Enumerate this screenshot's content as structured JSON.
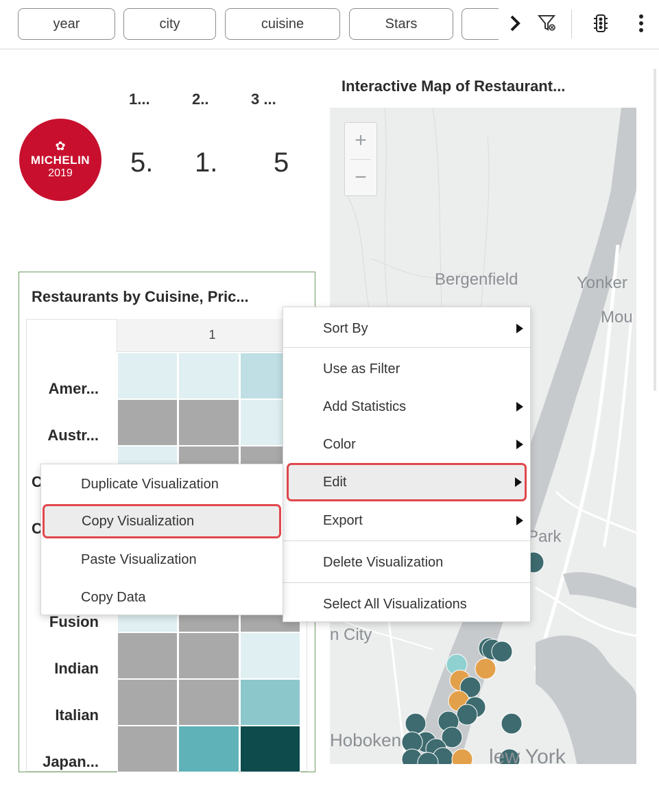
{
  "filterbar": {
    "pills": [
      "year",
      "city",
      "cuisine",
      "Stars",
      ""
    ],
    "icons": [
      "chevron-right-icon",
      "filter-icon",
      "traffic-light-icon",
      "kebab-menu-icon"
    ]
  },
  "kpi": {
    "headers": [
      "1...",
      "2..",
      "3 ..."
    ],
    "values": [
      "5.",
      "1.",
      "5"
    ],
    "badge": {
      "icon": "michelin-star-icon",
      "brand": "MICHELIN",
      "year": "2019"
    }
  },
  "heatmap": {
    "title": "Restaurants by Cuisine, Pric...",
    "column_header": "1",
    "rows": [
      "Amer...",
      "Austr...",
      "C",
      "C",
      "",
      "Fusion",
      "Indian",
      "Italian",
      "Japan..."
    ],
    "cell_colors": [
      "#ffffff",
      "#dfeff2",
      "#bfdfe4",
      "#8cc7cc",
      "#5fb2b7",
      "#0d4b4d",
      "#a9a9a9"
    ]
  },
  "map": {
    "title": "Interactive Map of Restaurant...",
    "zoom_in": "+",
    "zoom_out": "−",
    "labels": [
      "Bergenfield",
      "Yonker",
      "Mou",
      "Park",
      "n City",
      "Hoboken",
      "lew York",
      "ew York"
    ],
    "marker_colors": [
      "#3d6b6f",
      "#e3a04b",
      "#8fd1d0"
    ]
  },
  "context_menu": {
    "items": [
      {
        "label": "Sort By",
        "submenu": true
      },
      {
        "label": "Use as Filter",
        "submenu": false
      },
      {
        "label": "Add Statistics",
        "submenu": true
      },
      {
        "label": "Color",
        "submenu": true
      },
      {
        "label": "Edit",
        "submenu": true,
        "highlighted": true
      },
      {
        "label": "Export",
        "submenu": true
      },
      {
        "label": "Delete Visualization",
        "submenu": false
      },
      {
        "label": "Select All Visualizations",
        "submenu": false
      }
    ]
  },
  "edit_submenu": {
    "items": [
      {
        "label": "Duplicate Visualization"
      },
      {
        "label": "Copy Visualization",
        "highlighted": true
      },
      {
        "label": "Paste Visualization"
      },
      {
        "label": "Copy Data"
      }
    ]
  },
  "colors": {
    "highlight_border": "#e0474c",
    "panel_border": "#6f9a62",
    "michelin_red": "#c8102e"
  }
}
